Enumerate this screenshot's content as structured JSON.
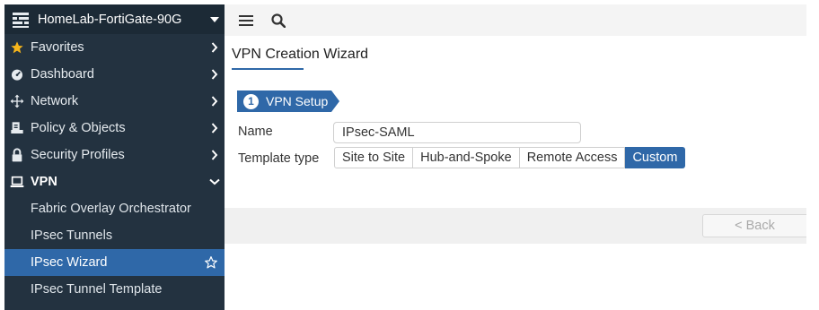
{
  "sidebar": {
    "device_name": "HomeLab-FortiGate-90G",
    "items": [
      {
        "label": "Favorites",
        "icon": "star-icon"
      },
      {
        "label": "Dashboard",
        "icon": "dashboard-gauge-icon"
      },
      {
        "label": "Network",
        "icon": "network-arrows-icon"
      },
      {
        "label": "Policy & Objects",
        "icon": "policy-document-icon"
      },
      {
        "label": "Security Profiles",
        "icon": "lock-icon"
      },
      {
        "label": "VPN",
        "icon": "laptop-icon"
      }
    ],
    "vpn_subitems": [
      {
        "label": "Fabric Overlay Orchestrator"
      },
      {
        "label": "IPsec Tunnels"
      },
      {
        "label": "IPsec Wizard"
      },
      {
        "label": "IPsec Tunnel Template"
      }
    ]
  },
  "main": {
    "page_title": "VPN Creation Wizard",
    "step": {
      "number": "1",
      "label": "VPN Setup"
    },
    "form": {
      "name_label": "Name",
      "name_value": "IPsec-SAML",
      "template_label": "Template type",
      "template_options": [
        "Site to Site",
        "Hub-and-Spoke",
        "Remote Access",
        "Custom"
      ],
      "template_selected": "Custom"
    },
    "back_label": "< Back"
  },
  "colors": {
    "sidebar_bg": "#233240",
    "accent": "#2f68a8",
    "star": "#f5b51b"
  }
}
